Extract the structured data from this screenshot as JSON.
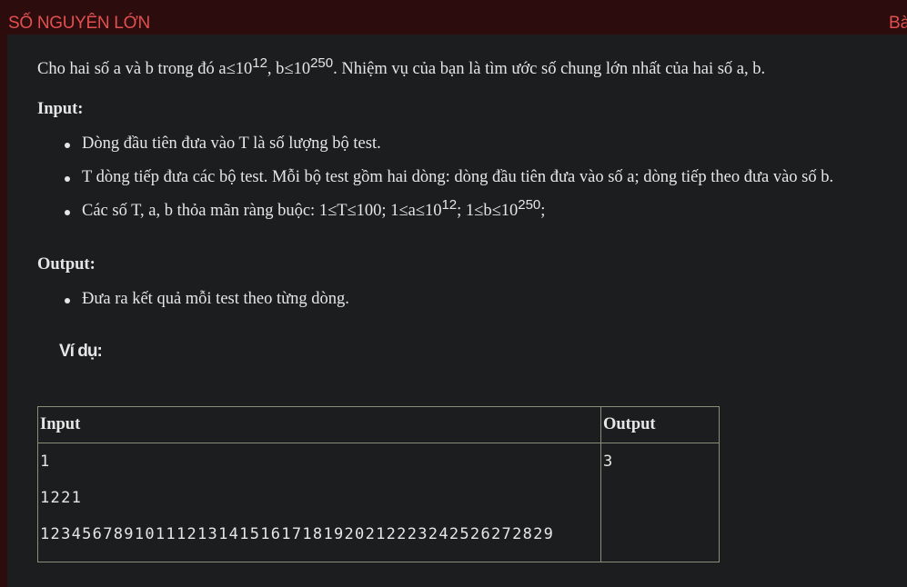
{
  "header": {
    "title": "SỐ NGUYÊN LỚN",
    "right_tab": "Bà"
  },
  "intro": {
    "part1": "Cho hai số a và b trong đó a≤10",
    "sup1": "12",
    "part2": ", b≤10",
    "sup2": "250",
    "part3": ". Nhiệm vụ của bạn là tìm ước số chung lớn nhất của hai số a, b."
  },
  "input_section": {
    "heading": "Input:",
    "items": [
      "Dòng đầu tiên đưa vào T là số lượng bộ test.",
      "T dòng tiếp đưa các bộ test. Mỗi bộ test gồm hai dòng: dòng đầu tiên đưa vào số a; dòng tiếp theo đưa vào số b."
    ],
    "constraint": {
      "part1": "Các số T, a, b thỏa mãn ràng buộc: 1≤T≤100; 1≤a≤10",
      "sup1": "12",
      "part2": "; 1≤b≤10",
      "sup2": "250",
      "part3": ";"
    }
  },
  "output_section": {
    "heading": "Output:",
    "items": [
      "Đưa ra kết quả mỗi test theo từng dòng."
    ]
  },
  "example": {
    "heading": "Ví dụ:",
    "table": {
      "headers": [
        "Input",
        "Output"
      ],
      "input_lines": [
        "1",
        "1221",
        "1234567891011121314151617181920212223242526272829"
      ],
      "output_lines": [
        "3"
      ]
    }
  }
}
